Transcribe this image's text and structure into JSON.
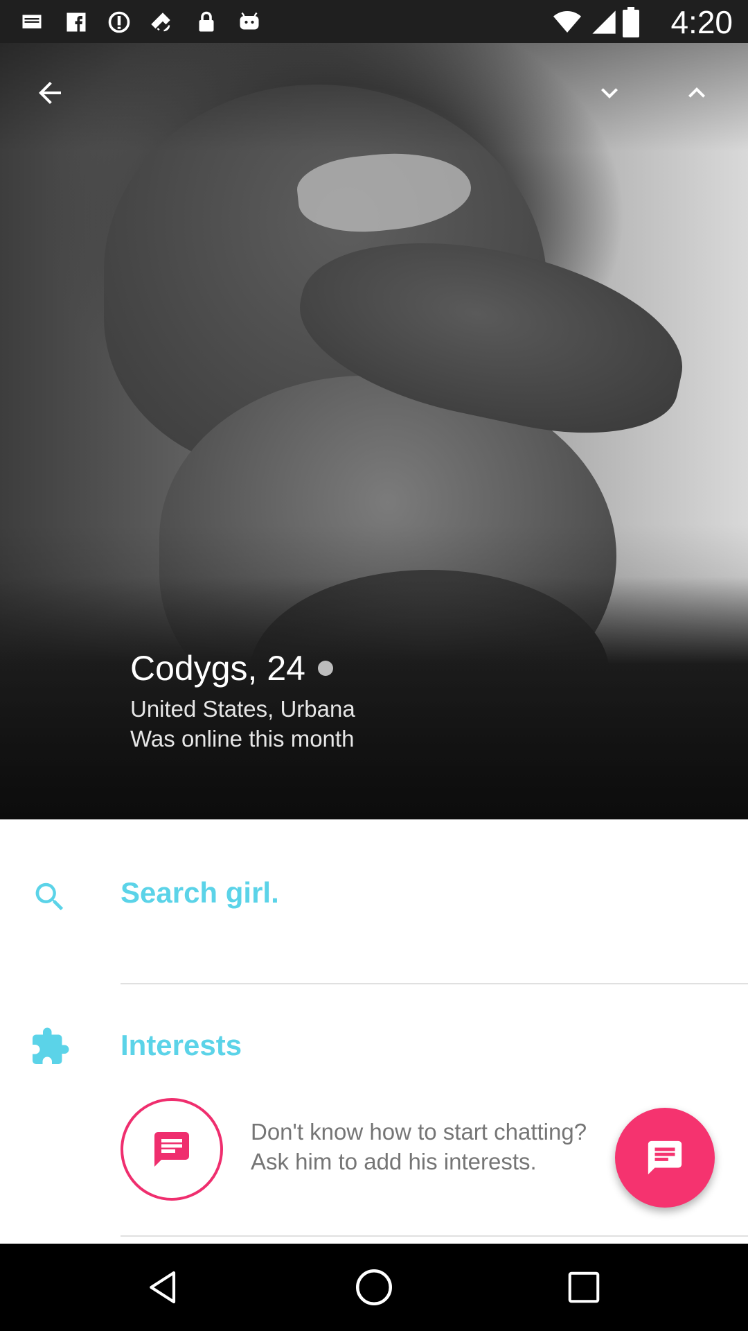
{
  "status_bar": {
    "time": "4:20",
    "icons": [
      "sms-icon",
      "facebook-icon",
      "sync-icon",
      "fake-gps-icon",
      "lock-icon",
      "android-icon",
      "wifi-icon",
      "signal-icon",
      "battery-icon"
    ]
  },
  "header": {
    "back_icon": "arrow-back-icon",
    "next_icon": "chevron-down-icon",
    "prev_icon": "chevron-up-icon"
  },
  "profile": {
    "name_age": "Codygs, 24",
    "location": "United States, Urbana",
    "last_seen": "Was online this month"
  },
  "search": {
    "label": "Search girl."
  },
  "interests": {
    "title": "Interests",
    "hint_line1": "Don't know how to start chatting?",
    "hint_line2": "Ask him to add his interests."
  },
  "colors": {
    "accent": "#5bd3e8",
    "pink": "#f5336f",
    "status_bar": "#1f1f1f"
  }
}
